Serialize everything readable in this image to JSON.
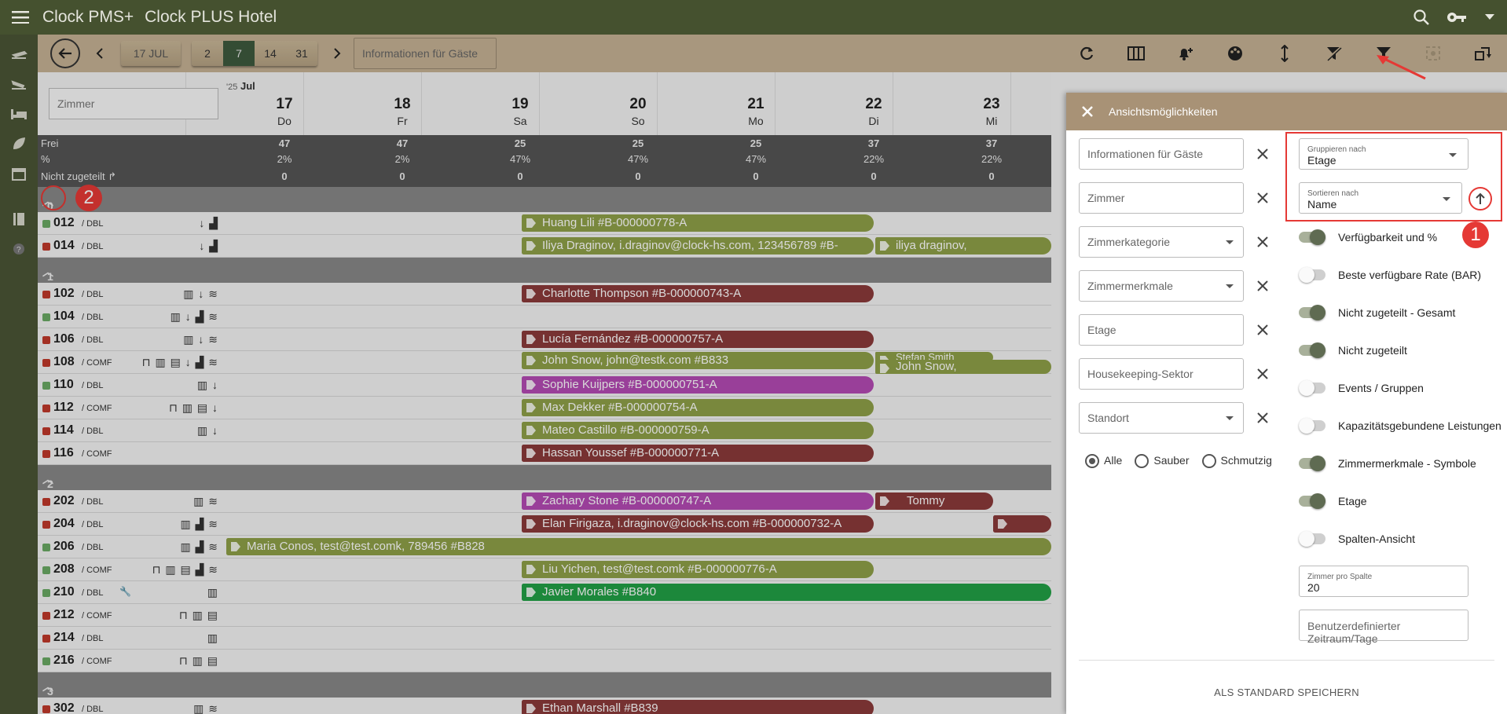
{
  "app": {
    "brand": "Clock PMS+",
    "hotel": "Clock PLUS Hotel"
  },
  "toolbar": {
    "date_button": "17 JUL",
    "ranges": [
      "2",
      "7",
      "14",
      "31"
    ],
    "active_range": "7",
    "guest_info": "Informationen für Gäste"
  },
  "grid": {
    "room_search_placeholder": "Zimmer",
    "year_prefix": "'25",
    "month": "Jul",
    "days": [
      {
        "n": "17",
        "w": "Do"
      },
      {
        "n": "18",
        "w": "Fr"
      },
      {
        "n": "19",
        "w": "Sa"
      },
      {
        "n": "20",
        "w": "So"
      },
      {
        "n": "21",
        "w": "Mo"
      },
      {
        "n": "22",
        "w": "Di"
      },
      {
        "n": "23",
        "w": "Mi"
      }
    ],
    "stats": {
      "frei_label": "Frei",
      "frei": [
        "47",
        "47",
        "25",
        "25",
        "25",
        "37",
        "37"
      ],
      "pct_label": "%",
      "pct": [
        "2%",
        "2%",
        "47%",
        "47%",
        "47%",
        "22%",
        "22%"
      ],
      "nz_label": "Nicht zugeteilt",
      "nz": [
        "0",
        "0",
        "0",
        "0",
        "0",
        "0",
        "0"
      ]
    },
    "groups": [
      {
        "label": "0",
        "rows": [
          {
            "num": "012",
            "cat": "/ DBL",
            "status": "clean",
            "feats": "↓ ▟"
          },
          {
            "num": "014",
            "cat": "/ DBL",
            "status": "dirty",
            "feats": "↓ ▟"
          }
        ]
      },
      {
        "label": "1",
        "rows": [
          {
            "num": "102",
            "cat": "/ DBL",
            "status": "dirty",
            "feats": "▥ ↓ ≋"
          },
          {
            "num": "104",
            "cat": "/ DBL",
            "status": "clean",
            "feats": "▥ ↓ ▟ ≋"
          },
          {
            "num": "106",
            "cat": "/ DBL",
            "status": "dirty",
            "feats": "▥ ↓ ≋"
          },
          {
            "num": "108",
            "cat": "/ COMF",
            "status": "dirty",
            "feats": "⊓ ▥ ▤ ↓ ▟ ≋"
          },
          {
            "num": "110",
            "cat": "/ DBL",
            "status": "clean",
            "feats": "▥ ↓"
          },
          {
            "num": "112",
            "cat": "/ COMF",
            "status": "dirty",
            "feats": "⊓ ▥ ▤ ↓"
          },
          {
            "num": "114",
            "cat": "/ DBL",
            "status": "dirty",
            "feats": "▥ ↓"
          },
          {
            "num": "116",
            "cat": "/ COMF",
            "status": "dirty",
            "feats": ""
          }
        ]
      },
      {
        "label": "2",
        "rows": [
          {
            "num": "202",
            "cat": "/ DBL",
            "status": "dirty",
            "feats": "▥ ≋"
          },
          {
            "num": "204",
            "cat": "/ DBL",
            "status": "dirty",
            "feats": "▥ ▟ ≋"
          },
          {
            "num": "206",
            "cat": "/ DBL",
            "status": "clean",
            "feats": "▥ ▟ ≋"
          },
          {
            "num": "208",
            "cat": "/ COMF",
            "status": "clean",
            "feats": "⊓ ▥ ▤ ▟ ≋"
          },
          {
            "num": "210",
            "cat": "/ DBL",
            "status": "clean",
            "feats": "▥",
            "wrench": "🔧"
          },
          {
            "num": "212",
            "cat": "/ COMF",
            "status": "dirty",
            "feats": "⊓ ▥ ▤"
          },
          {
            "num": "214",
            "cat": "/ DBL",
            "status": "dirty",
            "feats": "▥"
          },
          {
            "num": "216",
            "cat": "/ COMF",
            "status": "clean",
            "feats": "⊓ ▥ ▤"
          }
        ]
      },
      {
        "label": "3",
        "rows": [
          {
            "num": "302",
            "cat": "/ DBL",
            "status": "dirty",
            "feats": "▥ ≋"
          }
        ]
      }
    ],
    "bookings": [
      {
        "text": "Huang Lili #B-000000778-A",
        "color": "#8fa048"
      },
      {
        "text": "Iliya Draginov, i.draginov@clock-hs.com, 123456789 #B-",
        "color": "#8fa048"
      },
      {
        "text": "iliya draginov,",
        "color": "#8fa048"
      },
      {
        "text": "Charlotte Thompson #B-000000743-A",
        "color": "#8b3a3a"
      },
      {
        "text": "Lucía Fernández #B-000000757-A",
        "color": "#8b3a3a"
      },
      {
        "text": "John Snow, john@testk.com #B833",
        "color": "#8fa048"
      },
      {
        "text": "Stefan Smith",
        "color": "#8fa048"
      },
      {
        "text": "John Snow,",
        "color": "#8fa048"
      },
      {
        "text": "Sophie Kuijpers #B-000000751-A",
        "color": "#b44bb4"
      },
      {
        "text": "Max Dekker #B-000000754-A",
        "color": "#8fa048"
      },
      {
        "text": "Mateo Castillo #B-000000759-A",
        "color": "#8fa048"
      },
      {
        "text": "Hassan Youssef #B-000000771-A",
        "color": "#8b3a3a"
      },
      {
        "text": "Zachary Stone #B-000000747-A",
        "color": "#b44bb4"
      },
      {
        "text": "Tommy",
        "color": "#8b3a3a"
      },
      {
        "text": "Elan Firigaza, i.draginov@clock-hs.com #B-000000732-A",
        "color": "#8b3a3a"
      },
      {
        "text": "",
        "color": "#8b3a3a"
      },
      {
        "text": "Maria Conos, test@test.comk, 789456 #B828",
        "color": "#8fa048"
      },
      {
        "text": "Liu Yichen, test@test.comk #B-000000776-A",
        "color": "#8fa048"
      },
      {
        "text": "Javier Morales #B840",
        "color": "#22a046"
      },
      {
        "text": "Ethan Marshall #B839",
        "color": "#8b3a3a"
      }
    ]
  },
  "panel": {
    "title": "Ansichtsmöglichkeiten",
    "filters": [
      {
        "label": "Informationen für Gäste",
        "dropdown": false
      },
      {
        "label": "Zimmer",
        "dropdown": false
      },
      {
        "label": "Zimmerkategorie",
        "dropdown": true
      },
      {
        "label": "Zimmermerkmale",
        "dropdown": true
      },
      {
        "label": "Etage",
        "dropdown": false
      },
      {
        "label": "Housekeeping-Sektor",
        "dropdown": false
      },
      {
        "label": "Standort",
        "dropdown": true
      }
    ],
    "radios": {
      "all": "Alle",
      "clean": "Sauber",
      "dirty": "Schmutzig",
      "selected": "Alle"
    },
    "group_by": {
      "label": "Gruppieren nach",
      "value": "Etage"
    },
    "sort_by": {
      "label": "Sortieren nach",
      "value": "Name"
    },
    "toggles": [
      {
        "label": "Verfügbarkeit und %",
        "on": true
      },
      {
        "label": "Beste verfügbare Rate (BAR)",
        "on": false
      },
      {
        "label": "Nicht zugeteilt - Gesamt",
        "on": true
      },
      {
        "label": "Nicht zugeteilt",
        "on": true
      },
      {
        "label": "Events / Gruppen",
        "on": false
      },
      {
        "label": "Kapazitätsgebundene Leistungen",
        "on": false
      },
      {
        "label": "Zimmermerkmale - Symbole",
        "on": true
      },
      {
        "label": "Etage",
        "on": true
      },
      {
        "label": "Spalten-Ansicht",
        "on": false
      }
    ],
    "rooms_per_column": {
      "label": "Zimmer pro Spalte",
      "value": "20"
    },
    "custom_range_placeholder": "Benutzerdefinierter Zeitraum/Tage",
    "save_default": "ALS STANDARD SPEICHERN"
  },
  "annotations": {
    "badge1": "1",
    "badge2": "2"
  },
  "colors": {
    "topbar": "#45512f",
    "toolbar": "#c6b294",
    "clean": "#6aaa64",
    "dirty": "#c0392b",
    "panel_head": "#a89276",
    "highlight": "#e53935"
  }
}
